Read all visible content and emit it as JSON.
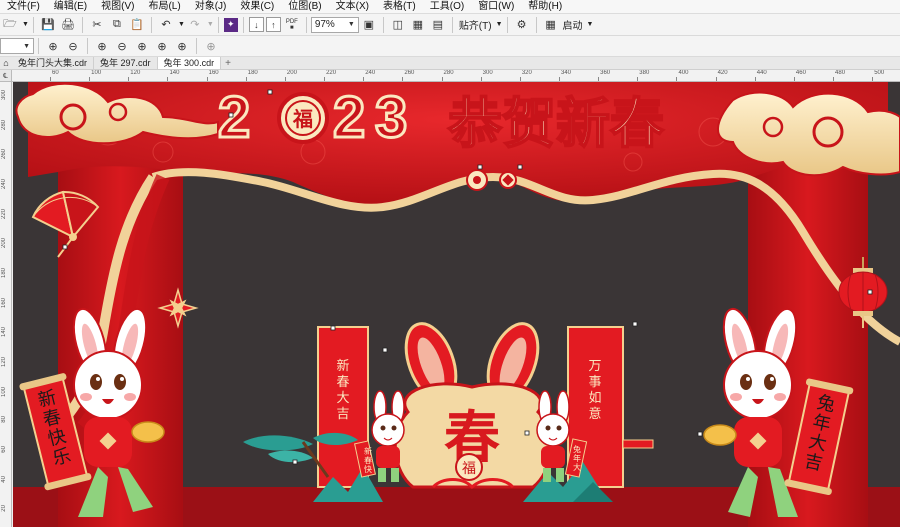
{
  "menu": {
    "items": [
      "文件(F)",
      "编辑(E)",
      "视图(V)",
      "布局(L)",
      "对象(J)",
      "效果(C)",
      "位图(B)",
      "文本(X)",
      "表格(T)",
      "工具(O)",
      "窗口(W)",
      "帮助(H)"
    ]
  },
  "toolbar": {
    "zoom_value": "97%",
    "snap_label": "贴齐(T)",
    "launch_label": "启动",
    "pdf_label": "PDF"
  },
  "property_bar": {
    "size_value": ""
  },
  "tabs": [
    {
      "label": "兔年门头大集.cdr",
      "active": false
    },
    {
      "label": "兔年 297.cdr",
      "active": false
    },
    {
      "label": "兔年 300.cdr",
      "active": true
    }
  ],
  "ruler": {
    "corner": "℄",
    "top_labels": [
      "60",
      "100",
      "120",
      "140",
      "160",
      "180",
      "200",
      "220",
      "240",
      "260",
      "280",
      "300",
      "320",
      "340",
      "360",
      "380",
      "400",
      "420",
      "440",
      "460",
      "480",
      "500"
    ],
    "left_labels": [
      "300",
      "280",
      "260",
      "240",
      "220",
      "200",
      "180",
      "160",
      "140",
      "120",
      "100",
      "80",
      "60",
      "40",
      "20"
    ]
  },
  "artwork": {
    "year_digits": [
      "2",
      "0",
      "2",
      "3"
    ],
    "fu": "福",
    "headline": "恭贺新春",
    "center_character": "春",
    "left_scroll": [
      "新",
      "春",
      "快",
      "乐"
    ],
    "right_scroll": [
      "兔",
      "年",
      "大",
      "吉"
    ],
    "left_banner": [
      "新",
      "春",
      "大",
      "吉"
    ],
    "right_banner": [
      "万",
      "事",
      "如",
      "意"
    ],
    "small_left_scroll": [
      "新",
      "春",
      "快",
      "乐"
    ],
    "small_right_scroll": [
      "兔",
      "年",
      "大",
      "吉"
    ]
  },
  "colors": {
    "red": "#d8191e",
    "dark_red": "#9e0f14",
    "gold": "#f3d9a4",
    "cream": "#fbe8c0",
    "canvas_bg": "#3a3536",
    "teal": "#2a9d92"
  }
}
